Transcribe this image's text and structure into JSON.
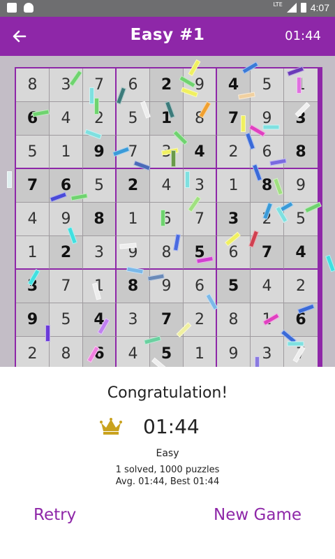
{
  "statusbar": {
    "network": "LTE",
    "time": "4:07"
  },
  "appbar": {
    "title": "Easy #1",
    "timer": "01:44"
  },
  "board": {
    "rows": [
      [
        "8",
        "3",
        "7",
        "6",
        "2",
        "9",
        "4",
        "5",
        "1"
      ],
      [
        "6",
        "4",
        "2",
        "5",
        "1",
        "8",
        "7",
        "9",
        "3"
      ],
      [
        "5",
        "1",
        "9",
        "7",
        "3",
        "4",
        "2",
        "6",
        "8"
      ],
      [
        "7",
        "6",
        "5",
        "2",
        "4",
        "3",
        "1",
        "8",
        "9"
      ],
      [
        "4",
        "9",
        "8",
        "1",
        "6",
        "7",
        "3",
        "2",
        "5"
      ],
      [
        "1",
        "2",
        "3",
        "9",
        "8",
        "5",
        "6",
        "7",
        "4"
      ],
      [
        "3",
        "7",
        "1",
        "8",
        "9",
        "6",
        "5",
        "4",
        "2"
      ],
      [
        "9",
        "5",
        "4",
        "3",
        "7",
        "2",
        "8",
        "1",
        "6"
      ],
      [
        "2",
        "8",
        "6",
        "4",
        "5",
        "1",
        "9",
        "3",
        "7"
      ]
    ],
    "given": [
      [
        0,
        0,
        0,
        0,
        1,
        0,
        1,
        0,
        0
      ],
      [
        1,
        0,
        0,
        0,
        1,
        0,
        1,
        0,
        1
      ],
      [
        0,
        0,
        1,
        0,
        0,
        1,
        0,
        0,
        1
      ],
      [
        1,
        1,
        0,
        1,
        0,
        0,
        0,
        1,
        0
      ],
      [
        0,
        0,
        1,
        0,
        0,
        0,
        1,
        0,
        0
      ],
      [
        0,
        1,
        0,
        0,
        0,
        1,
        0,
        1,
        1
      ],
      [
        1,
        0,
        0,
        1,
        0,
        0,
        1,
        0,
        0
      ],
      [
        1,
        0,
        1,
        0,
        1,
        0,
        0,
        0,
        1
      ],
      [
        0,
        0,
        1,
        0,
        1,
        0,
        0,
        0,
        0
      ]
    ]
  },
  "result": {
    "heading": "Congratulation!",
    "time": "01:44",
    "difficulty": "Easy",
    "solved_line": "1  solved, 1000 puzzles",
    "avg_line": "Avg. 01:44, Best 01:44",
    "retry_label": "Retry",
    "new_game_label": "New Game"
  },
  "icons": {
    "back": "back-arrow-icon",
    "crown": "crown-icon"
  },
  "colors": {
    "accent": "#8e27a8",
    "crown": "#c9a21e"
  }
}
